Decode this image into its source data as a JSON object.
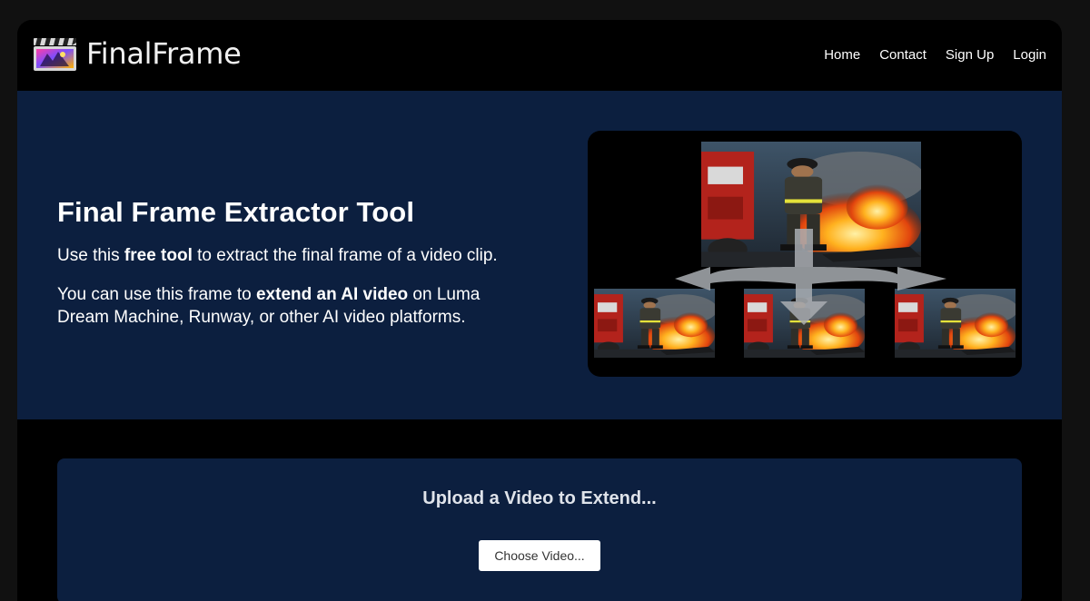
{
  "brand": {
    "name": "FinalFrame",
    "icon": "clapperboard-icon"
  },
  "nav": {
    "items": [
      "Home",
      "Contact",
      "Sign Up",
      "Login"
    ]
  },
  "hero": {
    "title": "Final Frame Extractor Tool",
    "p1": {
      "before": "Use this ",
      "bold": "free tool",
      "after": " to extract the final frame of a video clip."
    },
    "p2": {
      "before": "You can use this frame to ",
      "bold": "extend an AI video",
      "after": " on Luma Dream Machine, Runway, or other AI video platforms."
    },
    "image_alt": "firefighter-frames-illustration"
  },
  "upload": {
    "title": "Upload a Video to Extend...",
    "button_label": "Choose Video..."
  },
  "colors": {
    "page_bg": "#111111",
    "frame_bg": "#000000",
    "panel_bg": "#0c1f3f",
    "text": "#ffffff"
  }
}
